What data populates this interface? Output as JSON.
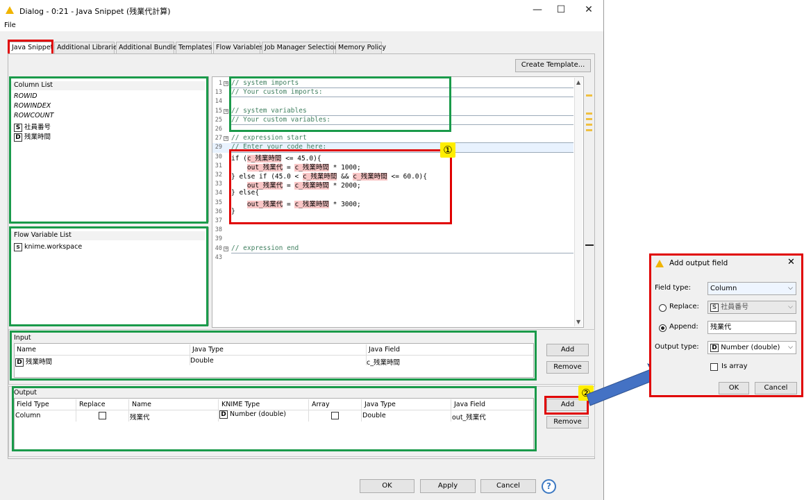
{
  "window": {
    "title": "Dialog - 0:21 - Java Snippet (残業代計算)",
    "minimize": "—",
    "maximize": "☐",
    "close": "✕"
  },
  "menu": {
    "file": "File"
  },
  "tabs": [
    "Java Snippet",
    "Additional Libraries",
    "Additional Bundles",
    "Templates",
    "Flow Variables",
    "Job Manager Selection",
    "Memory Policy"
  ],
  "create_template_label": "Create Template...",
  "column_list": {
    "header": "Column List",
    "items": [
      "ROWID",
      "ROWINDEX",
      "ROWCOUNT"
    ],
    "typed_items": [
      {
        "badge": "S",
        "label": "社員番号"
      },
      {
        "badge": "D",
        "label": "残業時間"
      }
    ]
  },
  "flow_variable_list": {
    "header": "Flow Variable List",
    "items": [
      {
        "badge": "s",
        "label": "knime.workspace"
      }
    ]
  },
  "editor": {
    "lines": [
      {
        "n": "1",
        "fold": true,
        "text": "// system imports"
      },
      {
        "n": "13",
        "fold": false,
        "text": "// Your custom imports:"
      },
      {
        "n": "14",
        "fold": false,
        "text": ""
      },
      {
        "n": "15",
        "fold": true,
        "text": "// system variables"
      },
      {
        "n": "25",
        "fold": false,
        "text": "// Your custom variables:"
      },
      {
        "n": "26",
        "fold": false,
        "text": ""
      },
      {
        "n": "27",
        "fold": true,
        "text": "// expression start"
      },
      {
        "n": "29",
        "fold": false,
        "text": "// Enter your code here:"
      },
      {
        "n": "30",
        "fold": false,
        "text": "if (c_残業時間 <= 45.0){"
      },
      {
        "n": "31",
        "fold": false,
        "text": "    out_残業代 = c_残業時間 * 1000;"
      },
      {
        "n": "32",
        "fold": false,
        "text": "} else if (45.0 < c_残業時間 && c_残業時間 <= 60.0){"
      },
      {
        "n": "33",
        "fold": false,
        "text": "    out_残業代 = c_残業時間 * 2000;"
      },
      {
        "n": "34",
        "fold": false,
        "text": "} else{"
      },
      {
        "n": "35",
        "fold": false,
        "text": "    out_残業代 = c_残業時間 * 3000;"
      },
      {
        "n": "36",
        "fold": false,
        "text": "}"
      },
      {
        "n": "37",
        "fold": false,
        "text": ""
      },
      {
        "n": "38",
        "fold": false,
        "text": ""
      },
      {
        "n": "39",
        "fold": false,
        "text": ""
      },
      {
        "n": "40",
        "fold": true,
        "text": "// expression end"
      },
      {
        "n": "43",
        "fold": false,
        "text": ""
      }
    ]
  },
  "input": {
    "title": "Input",
    "columns": [
      "Name",
      "Java Type",
      "Java Field"
    ],
    "row": {
      "badge": "D",
      "name": "残業時間",
      "java_type": "Double",
      "java_field": "c_残業時間"
    },
    "add": "Add",
    "remove": "Remove"
  },
  "output": {
    "title": "Output",
    "columns": [
      "Field Type",
      "Replace",
      "Name",
      "KNIME Type",
      "Array",
      "Java Type",
      "Java Field"
    ],
    "row": {
      "field_type": "Column",
      "name": "残業代",
      "badge": "D",
      "knime_type": "Number (double)",
      "java_type": "Double",
      "java_field": "out_残業代"
    },
    "add": "Add",
    "remove": "Remove"
  },
  "footer": {
    "ok": "OK",
    "apply": "Apply",
    "cancel": "Cancel",
    "help": "?"
  },
  "annotations": {
    "marker1": "①",
    "marker2": "②"
  },
  "add_output_field": {
    "title": "Add output field",
    "field_type_label": "Field type:",
    "field_type_value": "Column",
    "replace_label": "Replace:",
    "replace_badge": "S",
    "replace_value": "社員番号",
    "append_label": "Append:",
    "append_value": "残業代",
    "output_type_label": "Output type:",
    "output_type_badge": "D",
    "output_type_value": "Number (double)",
    "is_array_label": "Is array",
    "ok": "OK",
    "cancel": "Cancel"
  },
  "colors": {
    "green_box": "#1a9a4a",
    "red_box": "#e00000",
    "arrow": "#4472c4",
    "marker": "#ffee00"
  }
}
